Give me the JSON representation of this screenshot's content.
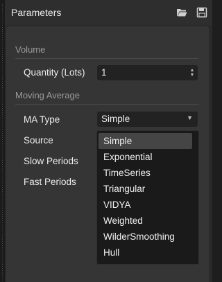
{
  "header": {
    "title": "Parameters",
    "icons": [
      "folder-open-icon",
      "save-icon"
    ]
  },
  "volume": {
    "section_title": "Volume",
    "quantity_label": "Quantity (Lots)",
    "quantity_value": "1"
  },
  "moving_average": {
    "section_title": "Moving Average",
    "ma_type_label": "MA Type",
    "ma_type_value": "Simple",
    "source_label": "Source",
    "slow_periods_label": "Slow Periods",
    "fast_periods_label": "Fast Periods",
    "options": [
      "Simple",
      "Exponential",
      "TimeSeries",
      "Triangular",
      "VIDYA",
      "Weighted",
      "WilderSmoothing",
      "Hull"
    ],
    "selected_index": 0
  },
  "colors": {
    "panel": "#383838",
    "header": "#2e2e2e",
    "field": "#222222",
    "dropdown": "#1a1a1a",
    "highlight": "#454545"
  }
}
